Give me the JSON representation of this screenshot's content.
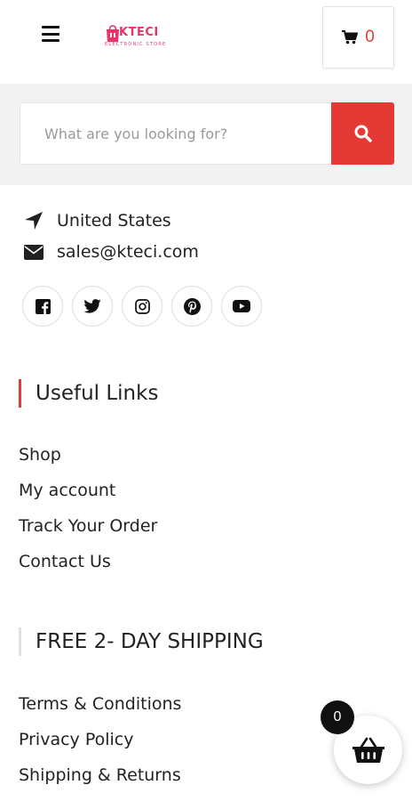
{
  "header": {
    "menu_icon": "hamburger-icon",
    "logo_text": "KTECI",
    "logo_subtitle": "ELECTRONIC STORE",
    "cart_icon": "shopping-cart-icon",
    "cart_count": "0",
    "brand_color": "#e8336b"
  },
  "search": {
    "placeholder": "What are you looking for?",
    "value": "",
    "button_icon": "search-icon",
    "button_color": "#e53935"
  },
  "contact": {
    "location": "United States",
    "location_icon": "location-arrow-icon",
    "email": "sales@kteci.com",
    "email_icon": "envelope-icon"
  },
  "socials": [
    "facebook-icon",
    "twitter-icon",
    "instagram-icon",
    "pinterest-icon",
    "youtube-icon"
  ],
  "useful_links": {
    "title": "Useful Links",
    "items": [
      "Shop",
      "My account",
      "Track Your Order",
      "Contact Us"
    ]
  },
  "shipping": {
    "title": "FREE 2- DAY SHIPPING",
    "items": [
      "Terms & Conditions",
      "Privacy Policy",
      "Shipping & Returns"
    ]
  },
  "floating_cart": {
    "icon": "basket-icon",
    "count": "0"
  },
  "accent_color": "#e53935"
}
